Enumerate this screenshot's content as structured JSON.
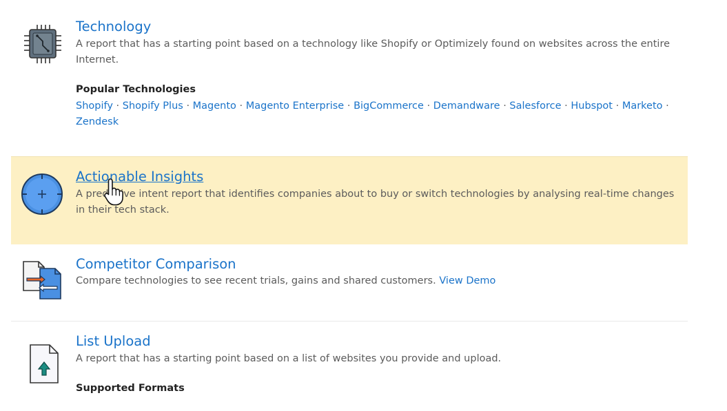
{
  "technology": {
    "title": "Technology",
    "description": "A report that has a starting point based on a technology like Shopify or Optimizely found on websites across the entire Internet.",
    "popular_heading": "Popular Technologies",
    "links": [
      "Shopify",
      "Shopify Plus",
      "Magento",
      "Magento Enterprise",
      "BigCommerce",
      "Demandware",
      "Salesforce",
      "Hubspot",
      "Marketo",
      "Zendesk"
    ],
    "separator": "·",
    "icon": "chip-icon"
  },
  "insights": {
    "title": "Actionable Insights",
    "description": "A predictive intent report that identifies companies about to buy or switch technologies by analysing real-time changes in their tech stack.",
    "icon": "target-clock-icon",
    "highlight_color": "#fdf0c4"
  },
  "competitor": {
    "title": "Competitor Comparison",
    "description": "Compare technologies to see recent trials, gains and shared customers.",
    "demo_link": "View Demo",
    "icon": "compare-documents-icon"
  },
  "list_upload": {
    "title": "List Upload",
    "description": "A report that has a starting point based on a list of websites you provide and upload.",
    "formats_heading": "Supported Formats",
    "icon": "upload-file-icon"
  },
  "colors": {
    "link": "#1a73c9",
    "text": "#5b5b5b",
    "heading": "#222222"
  }
}
